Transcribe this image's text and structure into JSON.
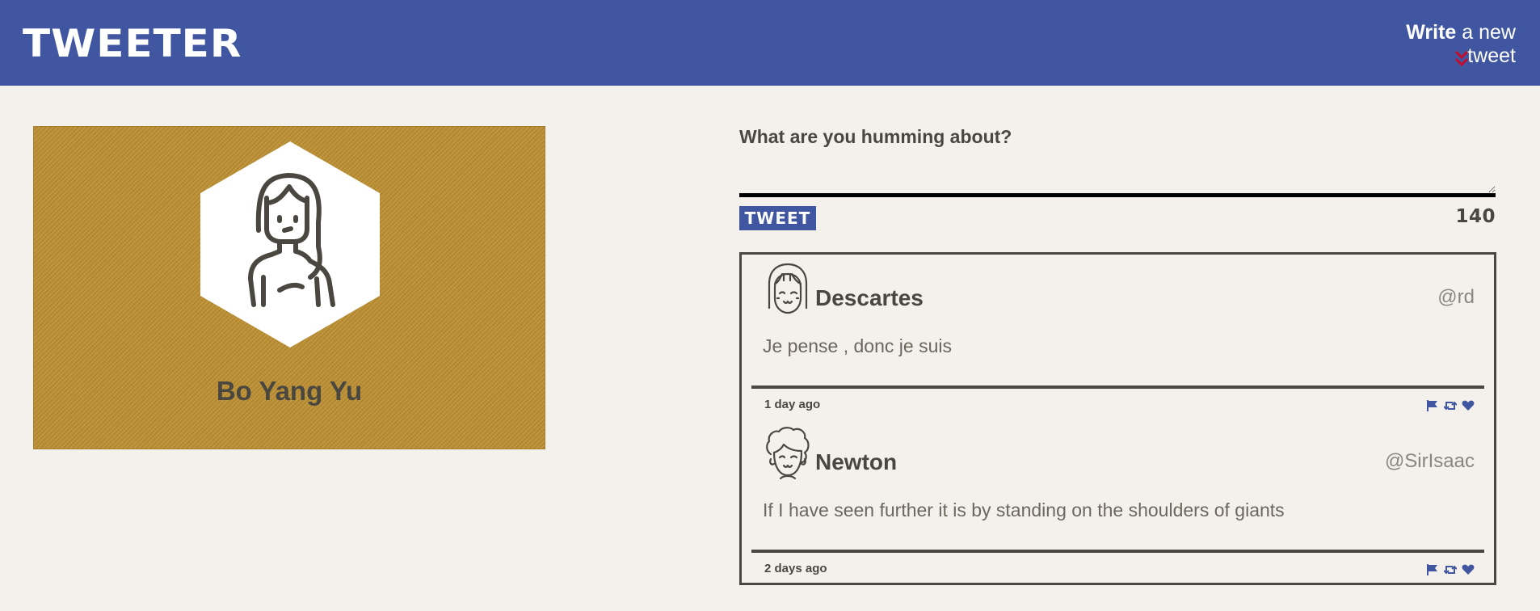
{
  "header": {
    "logo": "TWEETER",
    "compose_toggle": {
      "strong": "Write",
      "rest": " a new tweet"
    }
  },
  "profile": {
    "name": "Bo Yang Yu"
  },
  "compose": {
    "label": "What are you humming about?",
    "placeholder": "",
    "button_label": "TWEET",
    "counter": "140"
  },
  "tweets": [
    {
      "author": "Descartes",
      "handle": "@rd",
      "content": "Je pense , donc je suis",
      "time": "1 day ago"
    },
    {
      "author": "Newton",
      "handle": "@SirIsaac",
      "content": "If I have seen further it is by standing on the shoulders of giants",
      "time": "2 days ago"
    }
  ],
  "colors": {
    "brand": "#4056a1",
    "accent": "#c40b2a",
    "profile_bg": "#bc8e2f",
    "background": "#f4f1ec",
    "text": "#4a4740"
  },
  "icons": {
    "chevron": "double-chevron-down-icon",
    "flag": "flag-icon",
    "retweet": "retweet-icon",
    "like": "heart-icon"
  }
}
